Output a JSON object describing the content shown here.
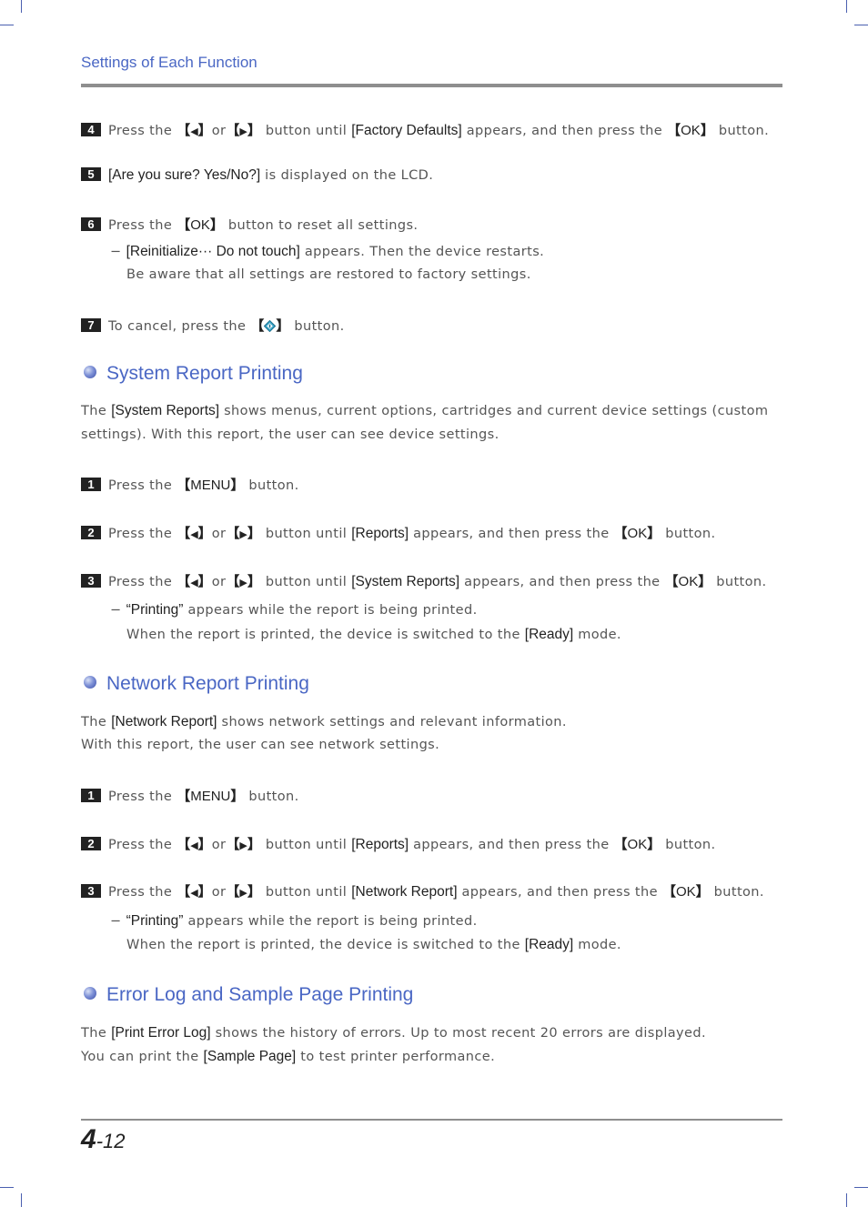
{
  "header": {
    "running_head": "Settings of Each Function"
  },
  "footer": {
    "chapter": "4",
    "page": "-12"
  },
  "keys": {
    "left": "◀",
    "right": "▶",
    "ok": "OK",
    "menu": "MENU",
    "or": "or"
  },
  "reset_steps": [
    {
      "num": "4",
      "pre": "Press the ",
      "mid": " button until ",
      "item": "[Factory Defaults]",
      "post": " appears, and then press the ",
      "end": " button."
    },
    {
      "num": "5",
      "item": "[Are you sure? Yes/No?]",
      "post": " is displayed on the LCD."
    },
    {
      "num": "6",
      "pre": "Press the ",
      "post": " button to reset all settings.",
      "sub_dash": "− ",
      "sub_item": "[Reinitialize··· Do not touch]",
      "sub_post": " appears. Then the device restarts.",
      "sub_line2": "Be aware that all settings are restored to factory settings."
    },
    {
      "num": "7",
      "pre": "To cancel, press the ",
      "icon": "stop-clear-icon",
      "post": " button."
    }
  ],
  "sections": [
    {
      "title": "System Report Printing",
      "desc_pre": "The ",
      "desc_item": "[System Reports]",
      "desc_post": " shows menus, current options, cartridges and current device settings (custom",
      "desc_line2": "settings). With this report, the user can see device settings.",
      "steps": [
        {
          "num": "1",
          "pre": "Press the ",
          "post": " button."
        },
        {
          "num": "2",
          "pre": "Press the ",
          "mid": " button until ",
          "item": "[Reports]",
          "post": " appears, and then press the ",
          "end": " button."
        },
        {
          "num": "3",
          "pre": "Press the ",
          "mid": " button until ",
          "item": "[System Reports]",
          "post": " appears, and then press the ",
          "end": " button."
        }
      ],
      "note": {
        "dash": "− ",
        "item": "“Printing”",
        "post": " appears while the report is being printed.",
        "line2_pre": "When the report is printed, the device is switched to the ",
        "line2_item": "[Ready]",
        "line2_post": " mode."
      }
    },
    {
      "title": "Network Report Printing",
      "desc_pre": "The ",
      "desc_item": "[Network Report]",
      "desc_post": " shows network settings and relevant information.",
      "desc_line2": "With this report, the user can see network settings.",
      "steps": [
        {
          "num": "1",
          "pre": "Press the ",
          "post": " button."
        },
        {
          "num": "2",
          "pre": "Press the ",
          "mid": " button until ",
          "item": "[Reports]",
          "post": " appears, and then press the ",
          "end": " button."
        },
        {
          "num": "3",
          "pre": "Press the ",
          "mid": " button until ",
          "item": "[Network Report]",
          "post": " appears, and then press the ",
          "end": " button."
        }
      ],
      "note": {
        "dash": "− ",
        "item": "“Printing”",
        "post": " appears while the report is being printed.",
        "line2_pre": "When the report is printed, the device is switched to the ",
        "line2_item": "[Ready]",
        "line2_post": " mode."
      }
    },
    {
      "title": "Error Log and Sample Page Printing",
      "line1_pre": "The ",
      "line1_item": "[Print Error Log]",
      "line1_post": " shows the history of errors. Up to most recent 20 errors are displayed.",
      "line2_pre": "You can print the ",
      "line2_item": "[Sample Page]",
      "line2_post": " to test printer performance."
    }
  ]
}
